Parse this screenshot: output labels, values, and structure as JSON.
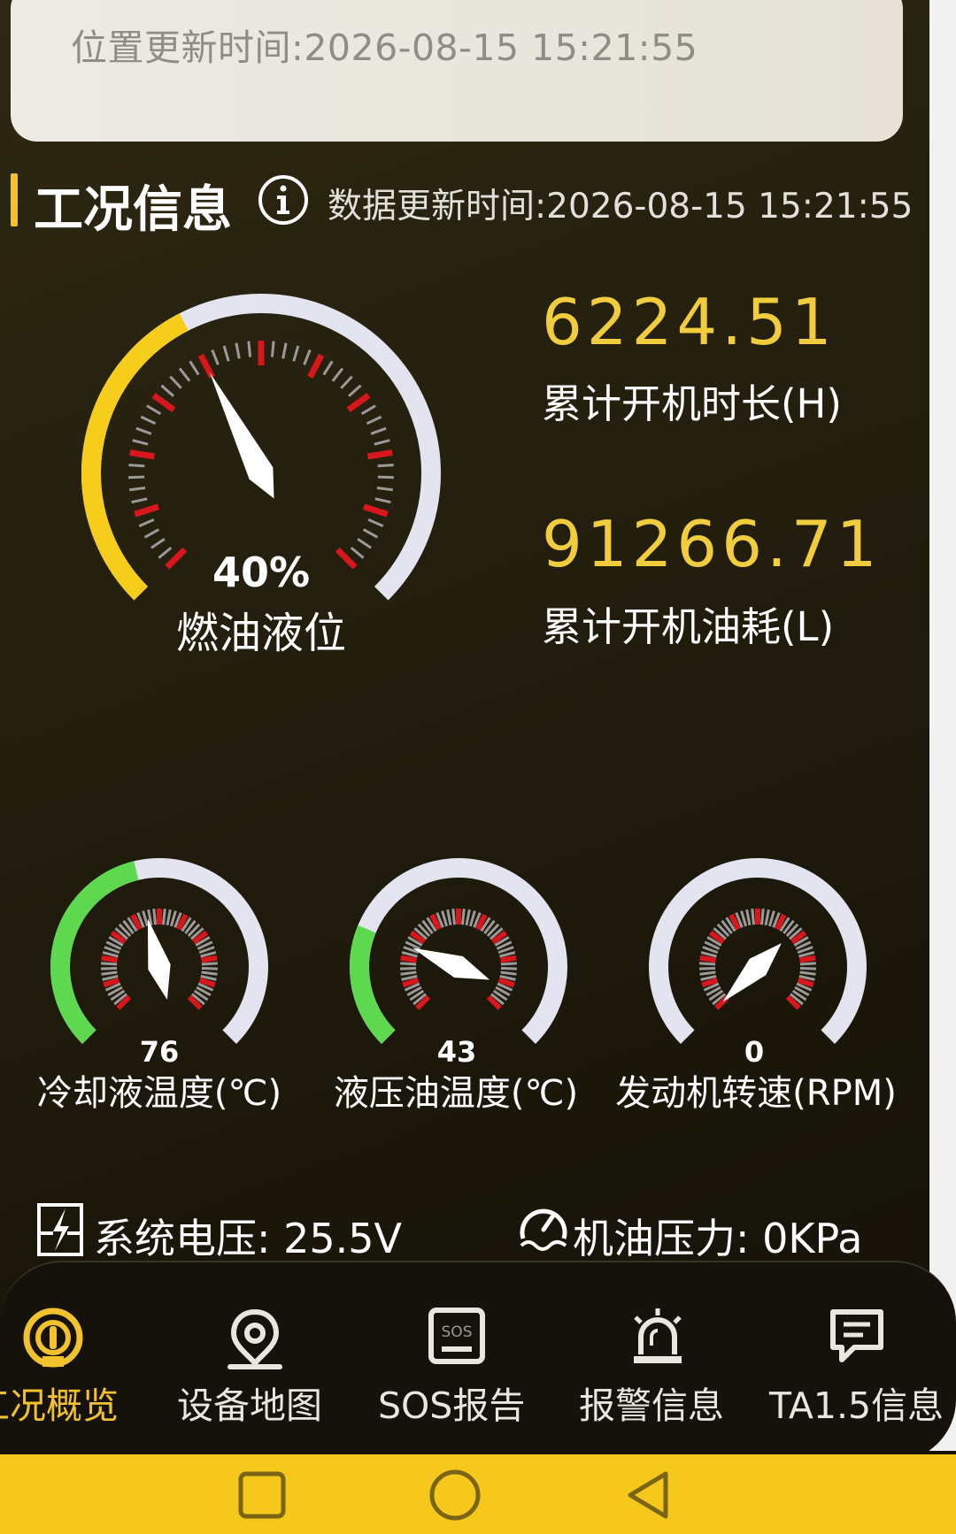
{
  "location": {
    "update_time_label": "位置更新时间:2026-08-15 15:21:55"
  },
  "section": {
    "title": "工况信息",
    "info_icon": "info-circle-icon",
    "data_time_label": "数据更新时间:2026-08-15 15:21:55"
  },
  "stats": {
    "hours_value": "6224.51",
    "hours_label": "累计开机时长(H)",
    "fuel_value": "91266.71",
    "fuel_label": "累计开机油耗(L)"
  },
  "gauges": {
    "fuel": {
      "value": "40%",
      "label": "燃油液位",
      "level": 0.4,
      "color": "#f7cd1c"
    },
    "coolant": {
      "value": "76",
      "label": "冷却液温度(℃)",
      "level": 0.45,
      "color": "#5ed94f"
    },
    "hydraulic": {
      "value": "43",
      "label": "液压油温度(℃)",
      "level": 0.25,
      "color": "#5ed94f"
    },
    "rpm": {
      "value": "0",
      "label": "发动机转速(RPM)",
      "level": 0,
      "color": "#5ed94f"
    }
  },
  "readouts": {
    "voltage_label": "系统电压: 25.5V",
    "voltage_icon": "battery-bolt-icon",
    "oil_pressure_label": "机油压力: 0KPa",
    "oil_pressure_icon": "pressure-gauge-icon"
  },
  "nav": {
    "items": [
      {
        "label": "工况概览",
        "icon": "dashboard-icon",
        "active": true
      },
      {
        "label": "设备地图",
        "icon": "map-pin-icon",
        "active": false
      },
      {
        "label": "SOS报告",
        "icon": "sos-icon",
        "active": false
      },
      {
        "label": "报警信息",
        "icon": "alarm-light-icon",
        "active": false
      },
      {
        "label": "TA1.5信息",
        "icon": "message-icon",
        "active": false
      }
    ]
  },
  "system_nav": {
    "recents_icon": "square-icon",
    "home_icon": "circle-icon",
    "back_icon": "triangle-back-icon"
  },
  "colors": {
    "accent": "#f1cd3d",
    "nav_active": "#f2c12e",
    "track": "#e3e4ef"
  }
}
